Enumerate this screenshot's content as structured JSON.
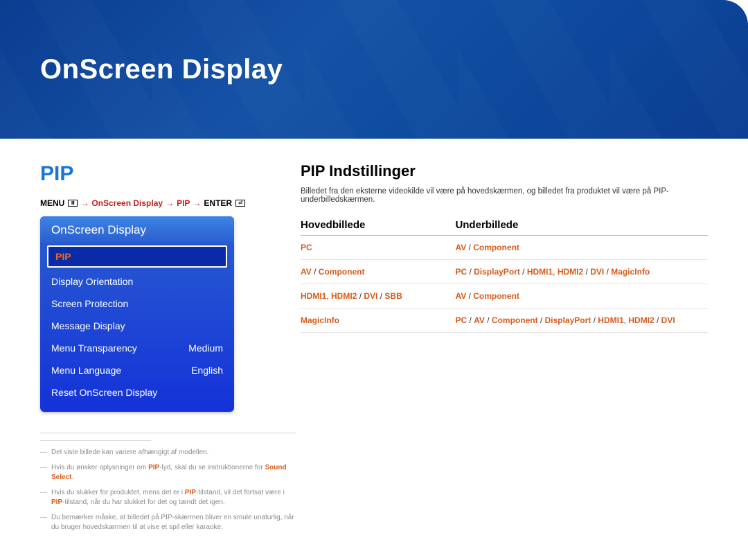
{
  "header": {
    "title": "OnScreen Display"
  },
  "left": {
    "pip_title": "PIP",
    "breadcrumb": {
      "menu": "MENU",
      "seg1": "OnScreen Display",
      "seg2": "PIP",
      "enter": "ENTER"
    },
    "osd": {
      "heading": "OnScreen Display",
      "items": [
        {
          "label": "PIP",
          "value": "",
          "selected": true
        },
        {
          "label": "Display Orientation",
          "value": ""
        },
        {
          "label": "Screen Protection",
          "value": ""
        },
        {
          "label": "Message Display",
          "value": ""
        },
        {
          "label": "Menu Transparency",
          "value": "Medium"
        },
        {
          "label": "Menu Language",
          "value": "English"
        },
        {
          "label": "Reset OnScreen Display",
          "value": ""
        }
      ]
    },
    "footnotes": {
      "n1": "Det viste billede kan variere afhængigt af modellen.",
      "n2a": "Hvis du ønsker oplysninger om ",
      "n2b": "PIP",
      "n2c": "-lyd, skal du se instruktionerne for ",
      "n2d": "Sound Select",
      "n2e": ".",
      "n3a": "Hvis du slukker for produktet, mens det er i ",
      "n3b": "PIP",
      "n3c": "-tilstand, vil det fortsat være i ",
      "n3d": "PIP",
      "n3e": "-tilstand, når du har slukket for det og tændt det igen.",
      "n4": "Du bemærker måske, at billedet på PIP-skærmen bliver en smule unaturlig, når du bruger hovedskærmen til at vise et spil eller karaoke."
    }
  },
  "right": {
    "heading": "PIP Indstillinger",
    "intro": "Billedet fra den eksterne videokilde vil være på hovedskærmen, og billedet fra produktet vil være på PIP-underbilledskærmen.",
    "col1": "Hovedbillede",
    "col2": "Underbillede",
    "rows": [
      {
        "c1_parts": [
          {
            "t": "PC"
          }
        ],
        "c2_parts": [
          {
            "t": "AV"
          },
          {
            "sep": " / "
          },
          {
            "t": "Component"
          }
        ]
      },
      {
        "c1_parts": [
          {
            "t": "AV"
          },
          {
            "sep": " / "
          },
          {
            "t": "Component"
          }
        ],
        "c2_parts": [
          {
            "t": "PC"
          },
          {
            "sep": " / "
          },
          {
            "t": "DisplayPort"
          },
          {
            "sep": " / "
          },
          {
            "t": "HDMI1"
          },
          {
            "sep": ", "
          },
          {
            "t": "HDMI2"
          },
          {
            "sep": " / "
          },
          {
            "t": "DVI"
          },
          {
            "sep": " / "
          },
          {
            "t": "MagicInfo"
          }
        ]
      },
      {
        "c1_parts": [
          {
            "t": "HDMI1"
          },
          {
            "sep": ", "
          },
          {
            "t": "HDMI2"
          },
          {
            "sep": " / "
          },
          {
            "t": "DVI"
          },
          {
            "sep": " / "
          },
          {
            "t": "SBB"
          }
        ],
        "c2_parts": [
          {
            "t": "AV"
          },
          {
            "sep": " / "
          },
          {
            "t": "Component"
          }
        ]
      },
      {
        "c1_parts": [
          {
            "t": "MagicInfo"
          }
        ],
        "c2_parts": [
          {
            "t": "PC"
          },
          {
            "sep": " / "
          },
          {
            "t": "AV"
          },
          {
            "sep": " / "
          },
          {
            "t": "Component"
          },
          {
            "sep": " / "
          },
          {
            "t": "DisplayPort"
          },
          {
            "sep": " / "
          },
          {
            "t": "HDMI1"
          },
          {
            "sep": ", "
          },
          {
            "t": "HDMI2"
          },
          {
            "sep": " / "
          },
          {
            "t": "DVI"
          }
        ]
      }
    ]
  }
}
